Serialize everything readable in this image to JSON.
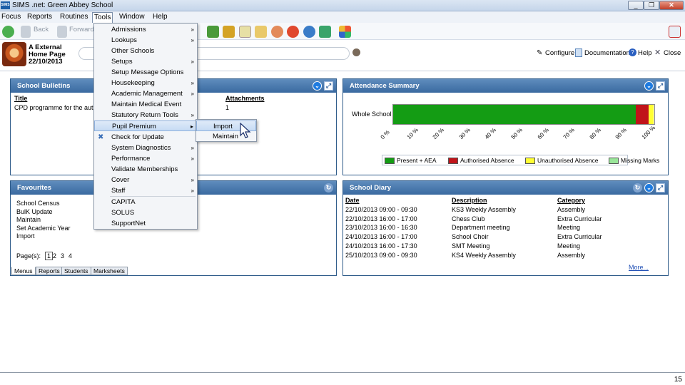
{
  "window": {
    "title": "SIMS .net: Green Abbey School",
    "app_icon": "SIMS",
    "controls": [
      "_",
      "❐",
      "✕"
    ]
  },
  "menubar": [
    "Focus",
    "Reports",
    "Routines",
    "Tools",
    "Window",
    "Help"
  ],
  "toolbar": {
    "back": "Back",
    "forward": "Forward"
  },
  "header": {
    "user_line1": "A External",
    "user_line2": "Home Page",
    "date": "22/10/2013",
    "configure": "Configure",
    "documentation": "Documentation",
    "help": "Help",
    "close": "Close"
  },
  "bulletins": {
    "title": "School Bulletins",
    "col_title": "Title",
    "col_attachments": "Attachments",
    "row_title": "CPD programme for the autum",
    "row_attachments": "1"
  },
  "attendance": {
    "title": "Attendance Summary",
    "row_label": "Whole School",
    "ticks": [
      "0 %",
      "10 %",
      "20 %",
      "30 %",
      "40 %",
      "50 %",
      "60 %",
      "70 %",
      "80 %",
      "90 %",
      "100 %"
    ]
  },
  "chart_data": {
    "type": "bar",
    "orientation": "horizontal-stacked",
    "categories": [
      "Whole School"
    ],
    "series": [
      {
        "name": "Present + AEA",
        "values": [
          93
        ],
        "color": "#149c14"
      },
      {
        "name": "Authorised Absence",
        "values": [
          5
        ],
        "color": "#c0141a"
      },
      {
        "name": "Unauthorised Absence",
        "values": [
          2
        ],
        "color": "#ffff33"
      },
      {
        "name": "Missing Marks",
        "values": [
          0
        ],
        "color": "#99e699"
      }
    ],
    "xlim": [
      0,
      100
    ],
    "legend": "bottom"
  },
  "favourites": {
    "title": "Favourites",
    "items": [
      "School Census",
      "BulK Update",
      "Maintain",
      "Set Academic Year",
      "Import"
    ],
    "pages_label": "Page(s):",
    "pages": [
      "1",
      "2",
      "3",
      "4"
    ],
    "tabs": [
      "Menus",
      "Reports",
      "Students",
      "Marksheets"
    ]
  },
  "diary": {
    "title": "School Diary",
    "headers": [
      "Date",
      "Description",
      "Category"
    ],
    "rows": [
      [
        "22/10/2013 09:00 - 09:30",
        "KS3 Weekly Assembly",
        "Assembly"
      ],
      [
        "22/10/2013 16:00 - 17:00",
        "Chess Club",
        "Extra Curricular"
      ],
      [
        "23/10/2013 16:00 - 16:30",
        "Department meeting",
        "Meeting"
      ],
      [
        "24/10/2013 16:00 - 17:00",
        "School Choir",
        "Extra Curricular"
      ],
      [
        "24/10/2013 16:00 - 17:30",
        "SMT Meeting",
        "Meeting"
      ],
      [
        "25/10/2013 09:00 - 09:30",
        "KS4 Weekly Assembly",
        "Assembly"
      ]
    ],
    "more": "More..."
  },
  "tools_menu": {
    "items": [
      {
        "label": "Admissions",
        "sub": true
      },
      {
        "label": "Lookups",
        "sub": true
      },
      {
        "label": "Other Schools",
        "sub": false
      },
      {
        "label": "Setups",
        "sub": true
      },
      {
        "label": "Setup Message Options",
        "sub": false
      },
      {
        "label": "Housekeeping",
        "sub": true
      },
      {
        "label": "Academic Management",
        "sub": true
      },
      {
        "label": "Maintain Medical Event",
        "sub": false
      },
      {
        "label": "Statutory Return Tools",
        "sub": true
      },
      {
        "label": "Pupil Premium",
        "sub": true
      },
      {
        "label": "Check for Update",
        "sub": false
      },
      {
        "label": "System Diagnostics",
        "sub": true
      },
      {
        "label": "Performance",
        "sub": true
      },
      {
        "label": "Validate Memberships",
        "sub": false
      },
      {
        "label": "Cover",
        "sub": true
      },
      {
        "label": "Staff",
        "sub": true
      },
      {
        "label": "CAPITA",
        "sub": false
      },
      {
        "label": "SOLUS",
        "sub": false
      },
      {
        "label": "SupportNet",
        "sub": false
      }
    ]
  },
  "pupil_premium_menu": [
    "Import",
    "Maintain"
  ],
  "slide_number": "15",
  "colors": {
    "panel_head": "#3a6aa0",
    "accent": "#1e7be0"
  }
}
